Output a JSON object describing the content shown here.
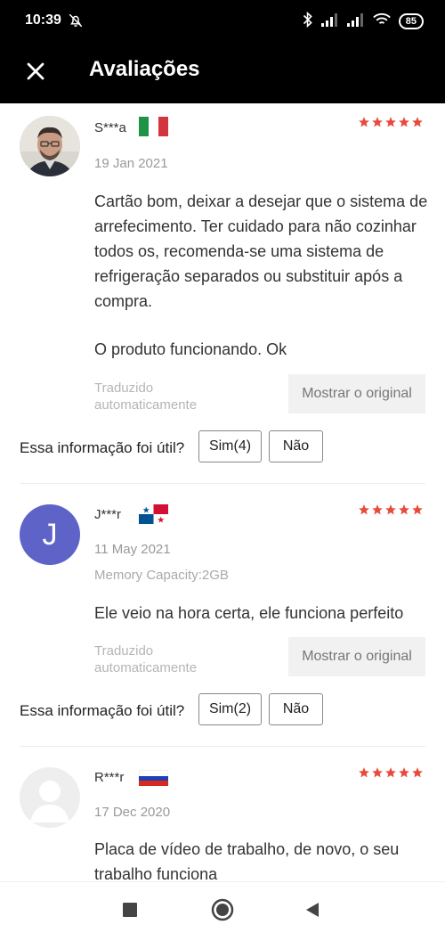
{
  "status_bar": {
    "time": "10:39",
    "battery": "85",
    "icons": [
      "do-not-disturb-icon",
      "bluetooth-icon",
      "signal-icon",
      "signal-icon",
      "wifi-icon",
      "battery-icon"
    ]
  },
  "app_bar": {
    "title": "Avaliações",
    "close_icon": "close-icon"
  },
  "colors": {
    "star": "#e84a3d",
    "avatar_letter_bg": "#5e63c8",
    "status_bg": "#000000"
  },
  "reviews": [
    {
      "name": "S***a",
      "country_flag": "italy-flag",
      "rating": 5,
      "date": "19 Jan 2021",
      "text": "Cartão bom, deixar a desejar que o sistema de arrefecimento. Ter cuidado para não cozinhar todos os, recomenda-se uma sistema de refrigeração separados ou substituir após a compra.",
      "text2": "O produto funcionando. Ok",
      "translated_label": "Traduzido automaticamente",
      "show_original": "Mostrar o original",
      "helpful_question": "Essa informação foi útil?",
      "yes_label": "Sim(4)",
      "no_label": "Não"
    },
    {
      "name": "J***r",
      "country_flag": "panama-flag",
      "avatar_letter": "J",
      "rating": 5,
      "date": "11 May 2021",
      "attribute": "Memory Capacity:2GB",
      "text": "Ele veio na hora certa, ele funciona perfeito",
      "translated_label": "Traduzido automaticamente",
      "show_original": "Mostrar o original",
      "helpful_question": "Essa informação foi útil?",
      "yes_label": "Sim(2)",
      "no_label": "Não"
    },
    {
      "name": "R***r",
      "country_flag": "russia-flag",
      "rating": 5,
      "date": "17 Dec 2020",
      "text": "Placa de vídeo de trabalho, de novo, o seu trabalho funciona"
    }
  ],
  "nav_bar": {
    "icons": [
      "recent-apps-icon",
      "home-icon",
      "back-icon"
    ]
  }
}
